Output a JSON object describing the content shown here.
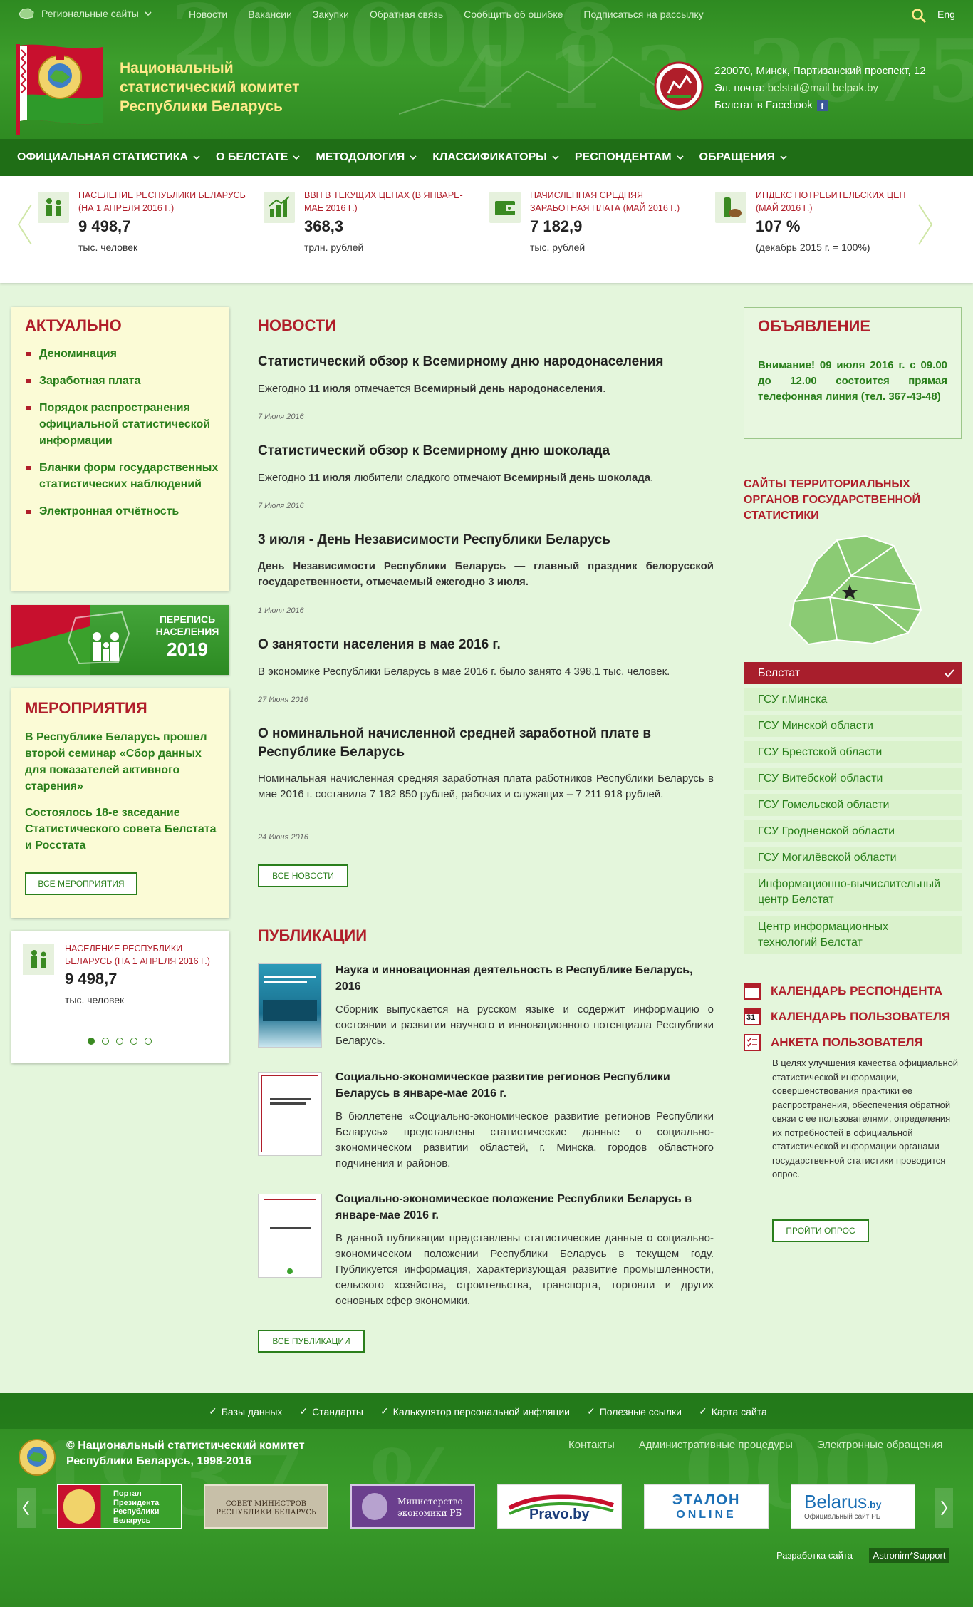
{
  "header": {
    "regional_label": "Региональные сайты",
    "top_links": [
      "Новости",
      "Вакансии",
      "Закупки",
      "Обратная связь",
      "Сообщить об ошибке",
      "Подписаться на рассылку"
    ],
    "lang": "Eng",
    "title_line1": "Национальный",
    "title_line2": "статистический комитет",
    "title_line3": "Республики Беларусь",
    "address": "220070, Минск, Партизанский проспект, 12",
    "email_label": "Эл. почта: ",
    "email": "belstat@mail.belpak.by",
    "facebook": "Белстат в Facebook"
  },
  "nav": [
    "ОФИЦИАЛЬНАЯ СТАТИСТИКА",
    "О БЕЛСТАТЕ",
    "МЕТОДОЛОГИЯ",
    "КЛАССИФИКАТОРЫ",
    "РЕСПОНДЕНТАМ",
    "ОБРАЩЕНИЯ"
  ],
  "indicators": [
    {
      "label": "Население Республики Беларусь (на 1 апреля 2016 г.)",
      "value": "9 498,7",
      "unit": "тыс. человек",
      "icon": "people-icon"
    },
    {
      "label": "ВВП в текущих ценах (в январе-мае 2016 г.)",
      "value": "368,3",
      "unit": "трлн. рублей",
      "icon": "chart-icon"
    },
    {
      "label": "Начисленная средняя заработная плата (май 2016 г.)",
      "value": "7 182,9",
      "unit": "тыс. рублей",
      "icon": "wallet-icon"
    },
    {
      "label": "Индекс потребительских цен (май 2016 г.)",
      "value": "107 %",
      "unit": "(декабрь 2015 г. = 100%)",
      "icon": "grocery-icon"
    }
  ],
  "actual": {
    "title": "АКТУАЛЬНО",
    "items": [
      "Деноминация",
      "Заработная плата",
      "Порядок распространения официальной статистической информации",
      "Бланки форм государственных статистических наблюдений",
      "Электронная отчётность"
    ]
  },
  "census": {
    "line1": "ПЕРЕПИСЬ",
    "line2": "НАСЕЛЕНИЯ",
    "year": "2019"
  },
  "events": {
    "title": "МЕРОПРИЯТИЯ",
    "items": [
      "В Республике Беларусь прошел второй семинар «Сбор данных для показателей активного старения»",
      "Состоялось 18-е заседание Статистического совета Белстата и Росстата"
    ],
    "button": "ВСЕ МЕРОПРИЯТИЯ"
  },
  "mini_indicator": {
    "label": "Население Республики Беларусь (на 1 апреля 2016 г.)",
    "value": "9 498,7",
    "unit": "тыс. человек"
  },
  "news": {
    "title": "НОВОСТИ",
    "items": [
      {
        "title": "Статистический обзор к Всемирному дню народонаселения",
        "text_pre": "Ежегодно ",
        "text_b1": "11 июля",
        "text_mid": " отмечается ",
        "text_b2": "Всемирный день народонаселения",
        "text_post": ".",
        "date": "7 Июля 2016"
      },
      {
        "title": "Статистический обзор к Всемирному дню шоколада",
        "text_pre": "Ежегодно ",
        "text_b1": "11 июля",
        "text_mid": " любители сладкого отмечают ",
        "text_b2": "Всемирный день шоколада",
        "text_post": ".",
        "date": "7 Июля 2016"
      },
      {
        "title": "3 июля - День Независимости Республики Беларусь",
        "text": "День Независимости Республики Беларусь — главный праздник белорусской государственности, отмечаемый ежегодно 3 июля.",
        "date": "1 Июля 2016"
      },
      {
        "title": "О занятости населения в мае 2016 г.",
        "text": "В экономике Республики Беларусь в мае 2016 г. было занято 4 398,1 тыс. человек.",
        "date": "27 Июня 2016"
      },
      {
        "title": "О номинальной начисленной средней заработной плате в Республике Беларусь",
        "text": "Номинальная начисленная средняя заработная плата работников Республики Беларусь в мае 2016 г. составила 7 182 850 рублей, рабочих и служащих – 7 211 918 рублей.",
        "date": "24 Июня 2016"
      }
    ],
    "button": "ВСЕ НОВОСТИ"
  },
  "publications": {
    "title": "ПУБЛИКАЦИИ",
    "items": [
      {
        "title": "Наука и инновационная деятельность в Республике Беларусь, 2016",
        "text": "Сборник выпускается на русском языке и содержит информацию о состоянии и развитии научного и инновационного потенциала Республики Беларусь."
      },
      {
        "title": "Социально-экономическое развитие регионов Республики Беларусь в январе-мае 2016 г.",
        "text": "В бюллетене «Социально-экономическое развитие регионов Республики Беларусь» представлены статистические данные о социально-экономическом развитии областей, г. Минска, городов областного подчинения и районов."
      },
      {
        "title": "Социально-экономическое положение Республики Беларусь в январе-мае 2016 г.",
        "text": "В данной публикации представлены статистические данные о социально-экономическом положении Республики Беларусь в текущем году. Публикуется информация, характеризующая развитие промышленности, сельского хозяйства, строительства, транспорта, торговли и других основных сфер экономики."
      }
    ],
    "button": "ВСЕ ПУБЛИКАЦИИ"
  },
  "announcement": {
    "title": "ОБЪЯВЛЕНИЕ",
    "text": "Внимание! 09 июля 2016 г. с 09.00 до 12.00 состоится прямая телефонная линия (тел. 367-43-48)"
  },
  "territorial": {
    "title": "САЙТЫ ТЕРРИТОРИАЛЬНЫХ ОРГАНОВ ГОСУДАРСТВЕННОЙ СТАТИСТИКИ",
    "items": [
      "Белстат",
      "ГСУ г.Минска",
      "ГСУ Минской области",
      "ГСУ Брестской области",
      "ГСУ Витебской области",
      "ГСУ Гомельской области",
      "ГСУ Гродненской области",
      "ГСУ Могилёвской области",
      "Информационно-вычислительный центр Белстат",
      "Центр информационных технологий Белстат"
    ]
  },
  "calendars": {
    "respondent": "КАЛЕНДАРЬ РЕСПОНДЕНТА",
    "user": "КАЛЕНДАРЬ ПОЛЬЗОВАТЕЛЯ",
    "survey": "АНКЕТА ПОЛЬЗОВАТЕЛЯ",
    "calendar_day": "31"
  },
  "survey": {
    "text": "В целях улучшения качества официальной статистической информации, совершенствования практики ее распространения, обеспечения обратной связи с ее пользователями, определения их потребностей в официальной статистической информации органами государственной статистики проводится опрос.",
    "button": "ПРОЙТИ ОПРОС"
  },
  "footer": {
    "links": [
      "Базы данных",
      "Стандарты",
      "Калькулятор персональной инфляции",
      "Полезные ссылки",
      "Карта сайта"
    ],
    "copyright1": "© Национальный статистический комитет",
    "copyright2": "Республики Беларусь, 1998-2016",
    "right_links": [
      "Контакты",
      "Административные процедуры",
      "Электронные обращения"
    ],
    "partners": [
      {
        "l1": "Портал",
        "l2": "Президента",
        "l3": "Республики",
        "l4": "Беларусь"
      },
      {
        "l1": "СОВЕТ МИНИСТРОВ",
        "l2": "РЕСПУБЛИКИ БЕЛАРУСЬ"
      },
      {
        "l1": "Министерство",
        "l2": "экономики РБ"
      },
      {
        "l1": "Pravo.by"
      },
      {
        "l1": "ЭТАЛОН",
        "l2": "ONLINE"
      },
      {
        "l1": "Belarus",
        "l2": ".by",
        "l3": "Официальный сайт РБ"
      }
    ],
    "dev_label": "Разработка сайта —",
    "dev_name": "Astronim*Support"
  }
}
